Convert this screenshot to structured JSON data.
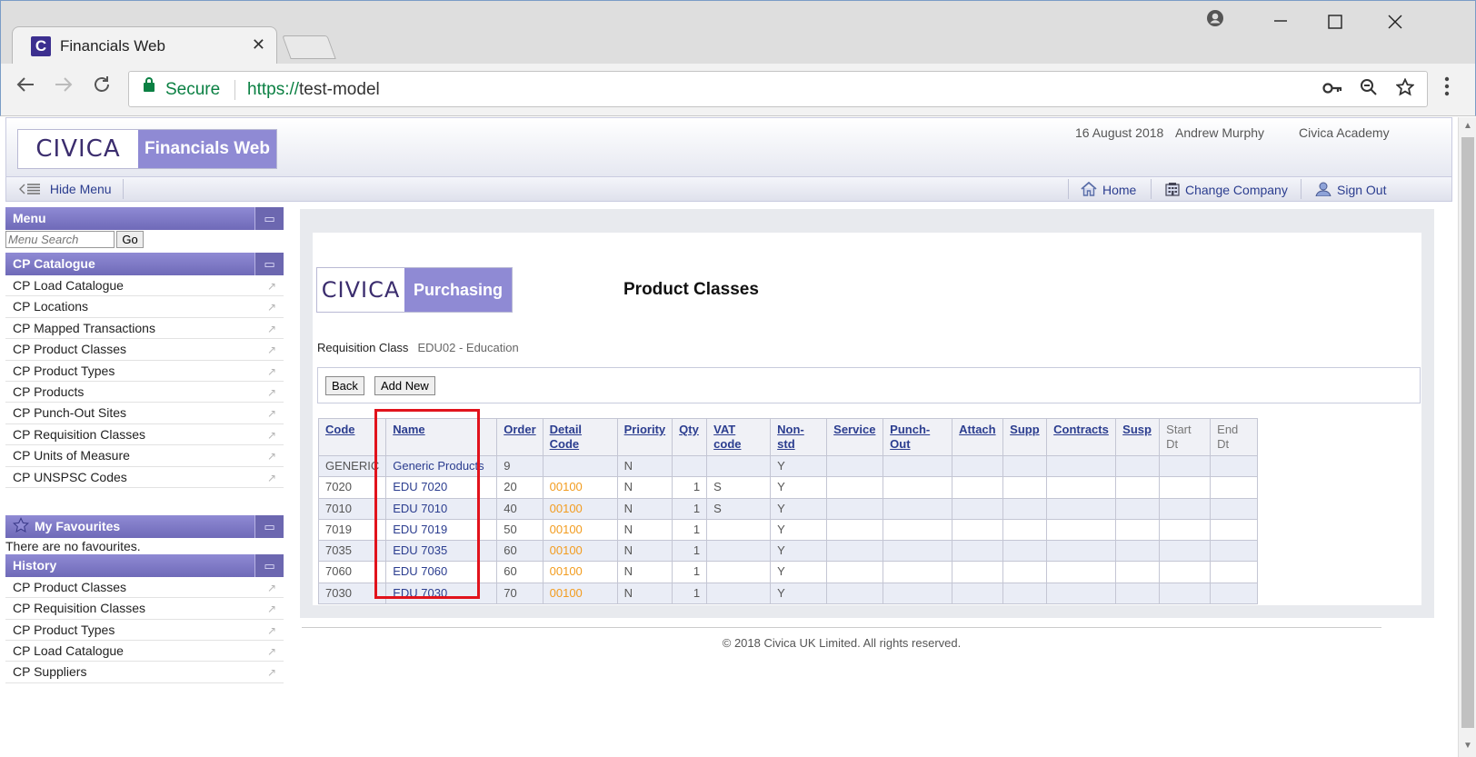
{
  "browser": {
    "tab_title": "Financials Web",
    "tab_close": "✕",
    "secure_label": "Secure",
    "url_scheme": "https://",
    "url_host": "test-model"
  },
  "header": {
    "logo_brand": "CIVICA",
    "logo_product": "Financials Web",
    "date": "16 August 2018",
    "user": "Andrew Murphy",
    "company": "Civica Academy"
  },
  "menubar": {
    "hide_menu": "Hide Menu",
    "home": "Home",
    "change_company": "Change Company",
    "sign_out": "Sign Out"
  },
  "sidebar": {
    "menu_title": "Menu",
    "search_placeholder": "Menu Search",
    "go_label": "Go",
    "catalogue_title": "CP Catalogue",
    "catalogue_items": [
      "CP Load Catalogue",
      "CP Locations",
      "CP Mapped Transactions",
      "CP Product Classes",
      "CP Product Types",
      "CP Products",
      "CP Punch-Out Sites",
      "CP Requisition Classes",
      "CP Units of Measure",
      "CP UNSPSC Codes"
    ],
    "favourites_title": "My Favourites",
    "favourites_empty": "There are no favourites.",
    "history_title": "History",
    "history_items": [
      "CP Product Classes",
      "CP Requisition Classes",
      "CP Product Types",
      "CP Load Catalogue",
      "CP Suppliers"
    ]
  },
  "main": {
    "logo_brand": "CIVICA",
    "logo_product": "Purchasing",
    "title": "Product Classes",
    "req_class_label": "Requisition Class",
    "req_class_value": "EDU02 - Education",
    "back_label": "Back",
    "add_new_label": "Add New",
    "table": {
      "headers": [
        [
          "Code"
        ],
        [
          "Name"
        ],
        [
          "Order"
        ],
        [
          "Detail",
          "Code"
        ],
        [
          "Priority"
        ],
        [
          "Qty"
        ],
        [
          "VAT",
          "code"
        ],
        [
          "Non-",
          "std"
        ],
        [
          "Service"
        ],
        [
          "Punch-",
          "Out"
        ],
        [
          "Attach"
        ],
        [
          "Supp"
        ],
        [
          "Contracts"
        ],
        [
          "Susp"
        ],
        [
          "Start",
          "Dt"
        ],
        [
          "End",
          "Dt"
        ]
      ],
      "rows": [
        [
          "GENERIC",
          "Generic Products",
          "9",
          "",
          "N",
          "",
          "",
          "Y",
          "",
          "",
          "",
          "",
          "",
          "",
          "",
          ""
        ],
        [
          "7020",
          "EDU 7020",
          "20",
          "00100",
          "N",
          "1",
          "S",
          "Y",
          "",
          "",
          "",
          "",
          "",
          "",
          "",
          ""
        ],
        [
          "7010",
          "EDU 7010",
          "40",
          "00100",
          "N",
          "1",
          "S",
          "Y",
          "",
          "",
          "",
          "",
          "",
          "",
          "",
          ""
        ],
        [
          "7019",
          "EDU 7019",
          "50",
          "00100",
          "N",
          "1",
          "",
          "Y",
          "",
          "",
          "",
          "",
          "",
          "",
          "",
          ""
        ],
        [
          "7035",
          "EDU 7035",
          "60",
          "00100",
          "N",
          "1",
          "",
          "Y",
          "",
          "",
          "",
          "",
          "",
          "",
          "",
          ""
        ],
        [
          "7060",
          "EDU 7060",
          "60",
          "00100",
          "N",
          "1",
          "",
          "Y",
          "",
          "",
          "",
          "",
          "",
          "",
          "",
          ""
        ],
        [
          "7030",
          "EDU 7030",
          "70",
          "00100",
          "N",
          "1",
          "",
          "Y",
          "",
          "",
          "",
          "",
          "",
          "",
          "",
          ""
        ]
      ]
    }
  },
  "footer": "© 2018 Civica UK Limited. All rights reserved.",
  "colors": {
    "accent": "#8f8ad4",
    "link": "#2b3d8f",
    "detail_code": "#f29c1f",
    "highlight": "#e1131c"
  }
}
